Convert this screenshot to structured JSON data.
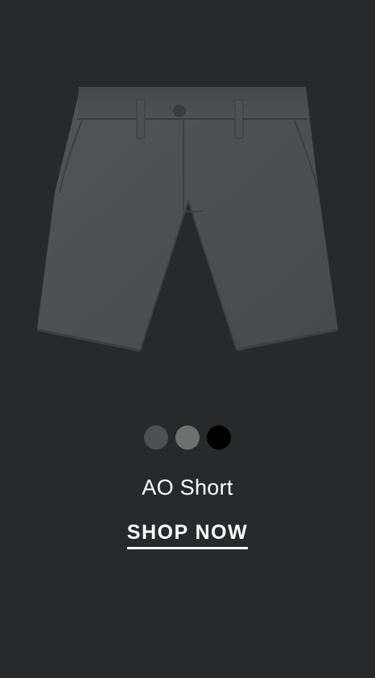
{
  "product": {
    "name": "AO Short",
    "cta_label": "SHOP NOW",
    "image_icon": "shorts-image"
  },
  "swatches": [
    {
      "color": "#4b5252",
      "label": ""
    },
    {
      "color": "#6f7070",
      "label": ""
    },
    {
      "color": "#000000",
      "label": ""
    }
  ],
  "colors": {
    "background": "#272a2b",
    "text": "#ffffff"
  }
}
